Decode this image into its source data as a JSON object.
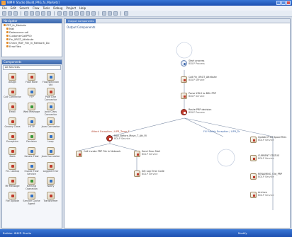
{
  "window": {
    "title": "IBM® Studio [Build_PRG_fx_Markets]"
  },
  "menu": [
    "File",
    "Edit",
    "Search",
    "Flow",
    "Tools",
    "Debug",
    "Project",
    "Help"
  ],
  "navigator": {
    "title": "Navigator",
    "items": [
      {
        "label": "PRT_fx_Markets",
        "level": 0
      },
      {
        "label": "Mail",
        "level": 1
      },
      {
        "label": "Datasource.udl",
        "level": 1
      },
      {
        "label": "CustomerCallPRO",
        "level": 1
      },
      {
        "label": "Fin_XRGT_Attribute",
        "level": 1
      },
      {
        "label": "Check_RDF_File_In_Network_Do",
        "level": 1
      },
      {
        "label": "ErrorFiles",
        "level": 1
      }
    ]
  },
  "components": {
    "title": "Components",
    "filter": "All Services",
    "items": [
      {
        "label": "Assign",
        "color": "red"
      },
      {
        "label": "Flow Note",
        "color": "red"
      },
      {
        "label": "Flow/Decision Util",
        "color": "blue"
      },
      {
        "label": "Call Connector",
        "color": "red"
      },
      {
        "label": "FTP",
        "color": "blue"
      },
      {
        "label": "Pipe Line Connector",
        "color": "red"
      },
      {
        "label": "Email",
        "color": "red"
      },
      {
        "label": "Web Message",
        "color": "green"
      },
      {
        "label": "Java Class Connector",
        "color": "blue"
      },
      {
        "label": "Groovy Class",
        "color": "red"
      },
      {
        "label": "HTTP",
        "color": "blue"
      },
      {
        "label": "Java Connector",
        "color": "blue"
      },
      {
        "label": "Exception",
        "color": "red"
      },
      {
        "label": "Decision",
        "color": "green"
      },
      {
        "label": "Loop",
        "color": "blue"
      },
      {
        "label": "Data",
        "color": "red"
      },
      {
        "label": "Iterate Flow",
        "color": "blue"
      },
      {
        "label": "Java Connector",
        "color": "blue"
      },
      {
        "label": "Fin. Lookup",
        "color": "red"
      },
      {
        "label": "Invoke Flow Service",
        "color": "blue"
      },
      {
        "label": "Logged Error",
        "color": "red"
      },
      {
        "label": "Mf Message",
        "color": "red"
      },
      {
        "label": "Naming Operation",
        "color": "green"
      },
      {
        "label": "Notify",
        "color": "blue"
      },
      {
        "label": "File Update",
        "color": "red"
      },
      {
        "label": "Service Cache Agent",
        "color": "blue"
      },
      {
        "label": "Transformer",
        "color": "red"
      }
    ]
  },
  "canvas": {
    "tab_label": "Output Components",
    "breadcrumb": "Output Components",
    "nodes": [
      {
        "id": "n1",
        "title": "Start process",
        "sub": "BDLP Process",
        "style": "circ"
      },
      {
        "id": "n2",
        "title": "Call Fin_XRGT_Attribute",
        "sub": "BDLP Service",
        "style": "plain"
      },
      {
        "id": "n3",
        "title": "Parse XRLS to BDL PRP",
        "sub": "BDLP Service",
        "style": "plain"
      },
      {
        "id": "n4",
        "title": "Route PRP decision",
        "sub": "BDLP Process",
        "style": "red"
      },
      {
        "id": "n5",
        "title": "Mail_Before_Move_T_Att_Fil",
        "sub": "BDLP Service",
        "style": "plain"
      },
      {
        "id": "n6",
        "title": "Call Invoke PRP File In Network",
        "sub": "",
        "style": "plain"
      },
      {
        "id": "n7",
        "title": "Send Error Mail",
        "sub": "BDLP Service",
        "style": "plain"
      },
      {
        "id": "n8",
        "title": "Set Log Error Code",
        "sub": "BDLP Service",
        "style": "plain"
      },
      {
        "id": "n9",
        "title": "Update Prior Spool Files",
        "sub": "BDLP Service",
        "style": "plain"
      },
      {
        "id": "n10",
        "title": "CURRENT STATUS",
        "sub": "BDLP Service",
        "style": "plain"
      },
      {
        "id": "n11",
        "title": "RENAMING_Old_PRP",
        "sub": "BDLP Service",
        "style": "plain"
      },
      {
        "id": "n12",
        "title": "Archive",
        "sub": "BDLP Service",
        "style": "plain"
      }
    ],
    "branch_labels": [
      "Attach Exception / LIPR_Temp_F",
      "Fill Publish Exception / LIPR_Te"
    ]
  },
  "statusbar": {
    "left": "Builder: IBM® Studio",
    "mode": "Modify"
  }
}
